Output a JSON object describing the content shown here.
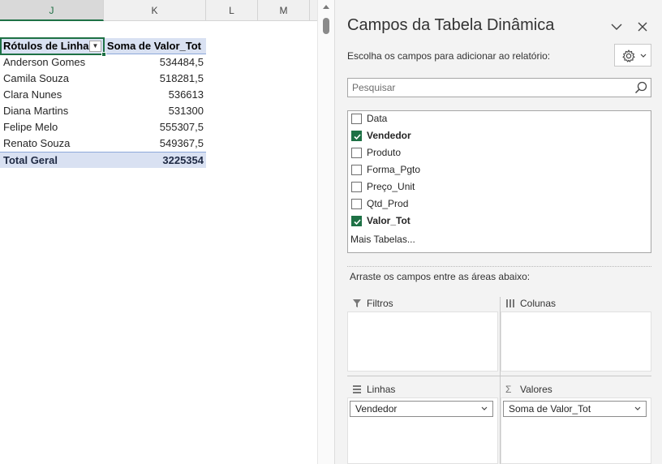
{
  "sheet": {
    "columns": [
      "J",
      "K",
      "L",
      "M"
    ],
    "pivot": {
      "header_label": "Rótulos de Linha",
      "header_value": "Soma de Valor_Tot",
      "rows": [
        {
          "label": "Anderson Gomes",
          "value": "534484,5"
        },
        {
          "label": "Camila Souza",
          "value": "518281,5"
        },
        {
          "label": "Clara Nunes",
          "value": "536613"
        },
        {
          "label": "Diana Martins",
          "value": "531300"
        },
        {
          "label": "Felipe Melo",
          "value": "555307,5"
        },
        {
          "label": "Renato Souza",
          "value": "549367,5"
        }
      ],
      "total_label": "Total Geral",
      "total_value": "3225354"
    }
  },
  "pane": {
    "title": "Campos da Tabela Dinâmica",
    "subtitle": "Escolha os campos para adicionar ao relatório:",
    "search_placeholder": "Pesquisar",
    "fields": [
      {
        "name": "Data",
        "checked": false
      },
      {
        "name": "Vendedor",
        "checked": true
      },
      {
        "name": "Produto",
        "checked": false
      },
      {
        "name": "Forma_Pgto",
        "checked": false
      },
      {
        "name": "Preço_Unit",
        "checked": false
      },
      {
        "name": "Qtd_Prod",
        "checked": false
      },
      {
        "name": "Valor_Tot",
        "checked": true
      }
    ],
    "more_tables": "Mais Tabelas...",
    "drag_hint": "Arraste os campos entre as áreas abaixo:",
    "areas": {
      "filtros": {
        "label": "Filtros",
        "icon": "filter-icon"
      },
      "colunas": {
        "label": "Colunas",
        "icon": "columns-icon"
      },
      "linhas": {
        "label": "Linhas",
        "icon": "rows-icon",
        "item": "Vendedor"
      },
      "valores": {
        "label": "Valores",
        "icon": "sigma-icon",
        "item": "Soma de Valor_Tot"
      }
    }
  },
  "colors": {
    "accent_green": "#1e7145",
    "pivot_header_bg": "#d9e1f2",
    "pane_bg": "#f3f3f3"
  }
}
